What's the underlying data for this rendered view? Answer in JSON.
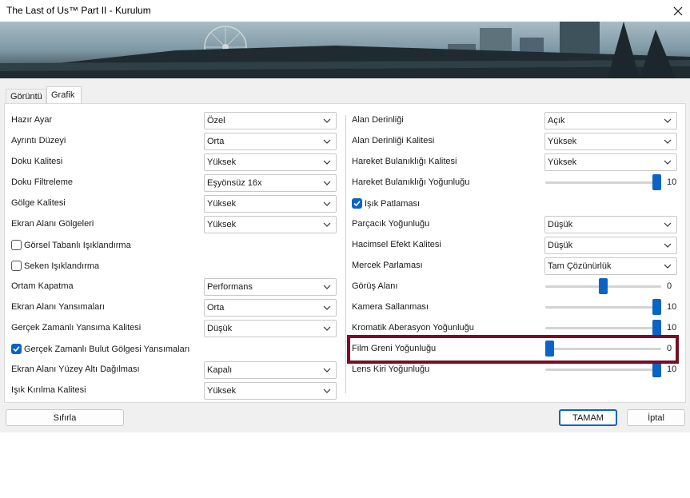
{
  "window": {
    "title": "The Last of Us™ Part II - Kurulum"
  },
  "tabs": [
    "Görüntü",
    "Grafik"
  ],
  "left": {
    "rows": [
      {
        "label": "Hazır Ayar",
        "value": "Özel"
      },
      {
        "label": "Ayrıntı Düzeyi",
        "value": "Orta"
      },
      {
        "label": "Doku Kalitesi",
        "value": "Yüksek"
      },
      {
        "label": "Doku Filtreleme",
        "value": "Eşyönsüz 16x"
      },
      {
        "label": "Gölge Kalitesi",
        "value": "Yüksek"
      },
      {
        "label": "Ekran Alanı Gölgeleri",
        "value": "Yüksek"
      },
      {
        "label": "Ortam Kapatma",
        "value": "Performans"
      },
      {
        "label": "Ekran Alanı Yansımaları",
        "value": "Orta"
      },
      {
        "label": "Gerçek Zamanlı Yansıma Kalitesi",
        "value": "Düşük"
      },
      {
        "label": "Ekran Alanı Yüzey Altı Dağılması",
        "value": "Kapalı"
      },
      {
        "label": "Işık Kırılma Kalitesi",
        "value": "Yüksek"
      }
    ],
    "checks": [
      {
        "label": "Görsel Tabanlı Işıklandırma",
        "checked": false
      },
      {
        "label": "Seken Işıklandırma",
        "checked": false
      },
      {
        "label": "Gerçek Zamanlı Bulut Gölgesi Yansımaları",
        "checked": true
      }
    ]
  },
  "right": {
    "rows": [
      {
        "label": "Alan Derinliği",
        "value": "Açık"
      },
      {
        "label": "Alan Derinliği Kalitesi",
        "value": "Yüksek"
      },
      {
        "label": "Hareket Bulanıklığı Kalitesi",
        "value": "Yüksek"
      },
      {
        "label": "Parçacık Yoğunluğu",
        "value": "Düşük"
      },
      {
        "label": "Hacimsel Efekt Kalitesi",
        "value": "Düşük"
      },
      {
        "label": "Mercek Parlaması",
        "value": "Tam Çözünürlük"
      }
    ],
    "sliders": [
      {
        "label": "Hareket Bulanıklığı Yoğunluğu",
        "value": "10",
        "level": 1.0
      },
      {
        "label": "Görüş Alanı",
        "value": "0",
        "level": 0.5
      },
      {
        "label": "Kamera Sallanması",
        "value": "10",
        "level": 1.0
      },
      {
        "label": "Kromatik Aberasyon Yoğunluğu",
        "value": "10",
        "level": 1.0
      },
      {
        "label": "Film Greni Yoğunluğu",
        "value": "0",
        "level": 0.0
      },
      {
        "label": "Lens Kiri Yoğunluğu",
        "value": "10",
        "level": 1.0
      }
    ],
    "check": {
      "label": "Işık Patlaması",
      "checked": true
    }
  },
  "buttons": {
    "reset": "Sıfırla",
    "ok": "TAMAM",
    "cancel": "İptal"
  },
  "colors": {
    "accent": "#0b63c5",
    "highlight": "#7a0d24"
  }
}
